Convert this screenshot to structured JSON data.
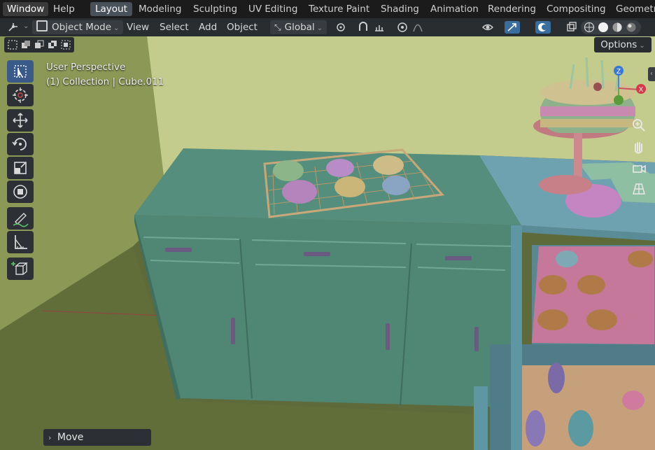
{
  "menubar": {
    "items": [
      {
        "label": "Window",
        "active": true
      },
      {
        "label": "Help",
        "active": false
      }
    ]
  },
  "workspaces": {
    "tabs": [
      {
        "label": "Layout",
        "active": true
      },
      {
        "label": "Modeling",
        "active": false
      },
      {
        "label": "Sculpting",
        "active": false
      },
      {
        "label": "UV Editing",
        "active": false
      },
      {
        "label": "Texture Paint",
        "active": false
      },
      {
        "label": "Shading",
        "active": false
      },
      {
        "label": "Animation",
        "active": false
      },
      {
        "label": "Rendering",
        "active": false
      },
      {
        "label": "Compositing",
        "active": false
      },
      {
        "label": "Geometr",
        "active": false
      }
    ]
  },
  "header": {
    "mode_label": "Object Mode",
    "view_label": "View",
    "select_label": "Select",
    "add_label": "Add",
    "object_label": "Object",
    "transform_orientation": "Global"
  },
  "options_label": "Options",
  "viewport": {
    "perspective_label": "User Perspective",
    "collection_label": "(1) Collection | Cube.011"
  },
  "gizmo": {
    "x": "X",
    "y": "Y",
    "z": "Z"
  },
  "last_operator": "Move",
  "colors": {
    "accent_active": "#3a5a8a",
    "menubar_bg": "#1b1b1b",
    "header_bg": "#2a2d30",
    "wall": "#b9c58a",
    "cabinet": "#4f8a78"
  },
  "icons": [
    "editor-type-icon",
    "object-mode-icon",
    "transform-orientation-icon",
    "snap-icon",
    "proportional-edit-icon",
    "visibility-icon",
    "gizmo-icon",
    "overlay-icon",
    "xray-icon",
    "shading-wireframe-icon",
    "shading-solid-icon",
    "shading-material-icon",
    "shading-rendered-icon",
    "select-box-icon",
    "cursor-icon",
    "move-icon",
    "rotate-icon",
    "scale-icon",
    "transform-icon",
    "annotate-icon",
    "measure-icon",
    "add-cube-icon",
    "zoom-icon",
    "pan-icon",
    "camera-icon",
    "grid-icon"
  ]
}
